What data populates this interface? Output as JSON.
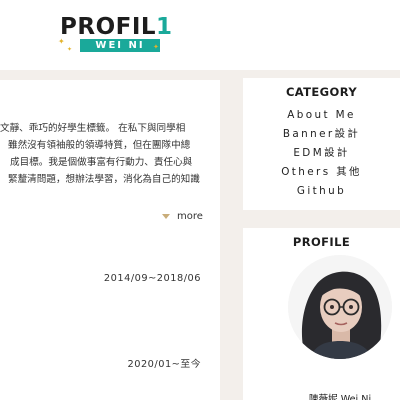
{
  "logo": {
    "title": "PROFIL",
    "title_num": "1",
    "subtitle": "WEI NI",
    "accent": "#1aa99a",
    "spark": "#e3b32b",
    "spark_glyph": "✦"
  },
  "intro": {
    "lines": [
      "文靜、乖巧的好學生標籤。 在私下與同學相",
      "雖然沒有領袖般的領導特質，但在團隊中總",
      "成目標。我是個做事富有行動力、責任心與",
      "緊釐清問題，想辦法學習，消化為自己的知識"
    ],
    "more_label": "more"
  },
  "timeline": {
    "date_1": "2014/09~2018/06",
    "date_2": "2020/01~至今"
  },
  "category": {
    "title": "CATEGORY",
    "items": [
      "About Me",
      "Banner設計",
      "EDM設計",
      "Others 其他",
      "Github"
    ]
  },
  "profile": {
    "title": "PROFILE",
    "name": "陳薇妮 Wei Ni",
    "avatar_icon": "person-avatar"
  }
}
